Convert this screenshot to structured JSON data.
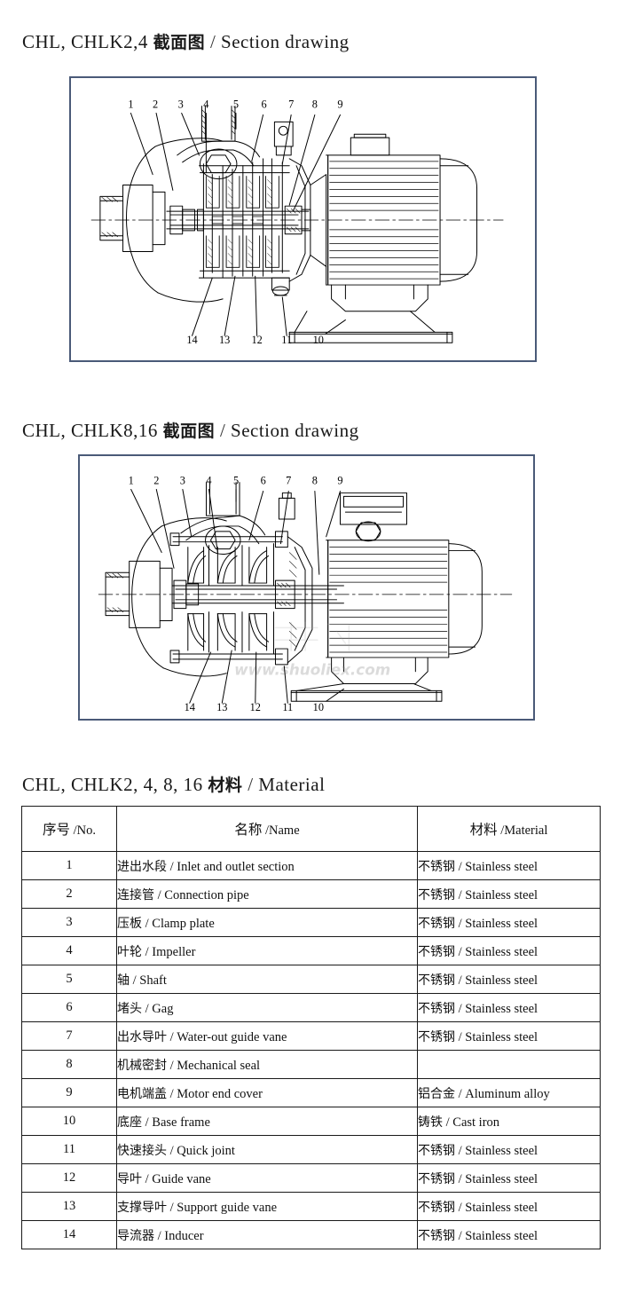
{
  "sections": [
    {
      "id": "section-1",
      "model": "CHL, CHLK2,4",
      "title_cn": "截面图",
      "separator": "/",
      "title_en": "Section drawing",
      "drawing": {
        "name": "chl-chlk2-4-section-drawing",
        "callouts_top": [
          "1",
          "2",
          "3",
          "4",
          "5",
          "6",
          "7",
          "8",
          "9"
        ],
        "callouts_bottom": [
          "14",
          "13",
          "12",
          "11",
          "10"
        ],
        "frame_color": "#4a5a78"
      }
    },
    {
      "id": "section-2",
      "model": "CHL, CHLK8,16",
      "title_cn": "截面图",
      "separator": "/",
      "title_en": "Section drawing",
      "drawing": {
        "name": "chl-chlk8-16-section-drawing",
        "callouts_top": [
          "1",
          "2",
          "3",
          "4",
          "5",
          "6",
          "7",
          "8",
          "9"
        ],
        "callouts_bottom": [
          "14",
          "13",
          "12",
          "11",
          "10"
        ],
        "watermark": "www.shuoliex.com",
        "frame_color": "#4a5a78"
      }
    },
    {
      "id": "section-3",
      "model": "CHL, CHLK2, 4, 8, 16",
      "title_cn": "材料",
      "separator": "/",
      "title_en": "Material"
    }
  ],
  "material_table": {
    "headers": [
      {
        "cn": "序号",
        "sep": "/",
        "en": "No."
      },
      {
        "cn": "名称",
        "sep": "/",
        "en": "Name"
      },
      {
        "cn": "材料",
        "sep": "/",
        "en": "Material"
      }
    ],
    "rows": [
      {
        "no": "1",
        "name_cn": "进出水段",
        "name_en": "Inlet and outlet section",
        "mat_cn": "不锈钢",
        "mat_en": "Stainless steel"
      },
      {
        "no": "2",
        "name_cn": "连接管",
        "name_en": "Connection pipe",
        "mat_cn": "不锈钢",
        "mat_en": "Stainless steel"
      },
      {
        "no": "3",
        "name_cn": "压板",
        "name_en": "Clamp plate",
        "mat_cn": "不锈钢",
        "mat_en": "Stainless steel"
      },
      {
        "no": "4",
        "name_cn": "叶轮",
        "name_en": "Impeller",
        "mat_cn": "不锈钢",
        "mat_en": "Stainless steel"
      },
      {
        "no": "5",
        "name_cn": "轴",
        "name_en": "Shaft",
        "mat_cn": "不锈钢",
        "mat_en": "Stainless steel"
      },
      {
        "no": "6",
        "name_cn": "堵头",
        "name_en": "Gag",
        "mat_cn": "不锈钢",
        "mat_en": "Stainless steel"
      },
      {
        "no": "7",
        "name_cn": "出水导叶",
        "name_en": "Water-out guide vane",
        "mat_cn": "不锈钢",
        "mat_en": "Stainless steel"
      },
      {
        "no": "8",
        "name_cn": "机械密封",
        "name_en": "Mechanical seal",
        "mat_cn": "",
        "mat_en": ""
      },
      {
        "no": "9",
        "name_cn": "电机端盖",
        "name_en": "Motor end cover",
        "mat_cn": "铝合金",
        "mat_en": "Aluminum alloy"
      },
      {
        "no": "10",
        "name_cn": "底座",
        "name_en": "Base frame",
        "mat_cn": "铸铁",
        "mat_en": "Cast iron"
      },
      {
        "no": "11",
        "name_cn": "快速接头",
        "name_en": "Quick joint",
        "mat_cn": "不锈钢",
        "mat_en": "Stainless steel"
      },
      {
        "no": "12",
        "name_cn": "导叶",
        "name_en": "Guide vane",
        "mat_cn": "不锈钢",
        "mat_en": "Stainless steel"
      },
      {
        "no": "13",
        "name_cn": "支撑导叶",
        "name_en": "Support guide vane",
        "mat_cn": "不锈钢",
        "mat_en": "Stainless steel"
      },
      {
        "no": "14",
        "name_cn": "导流器",
        "name_en": "Inducer",
        "mat_cn": "不锈钢",
        "mat_en": "Stainless steel"
      }
    ]
  }
}
